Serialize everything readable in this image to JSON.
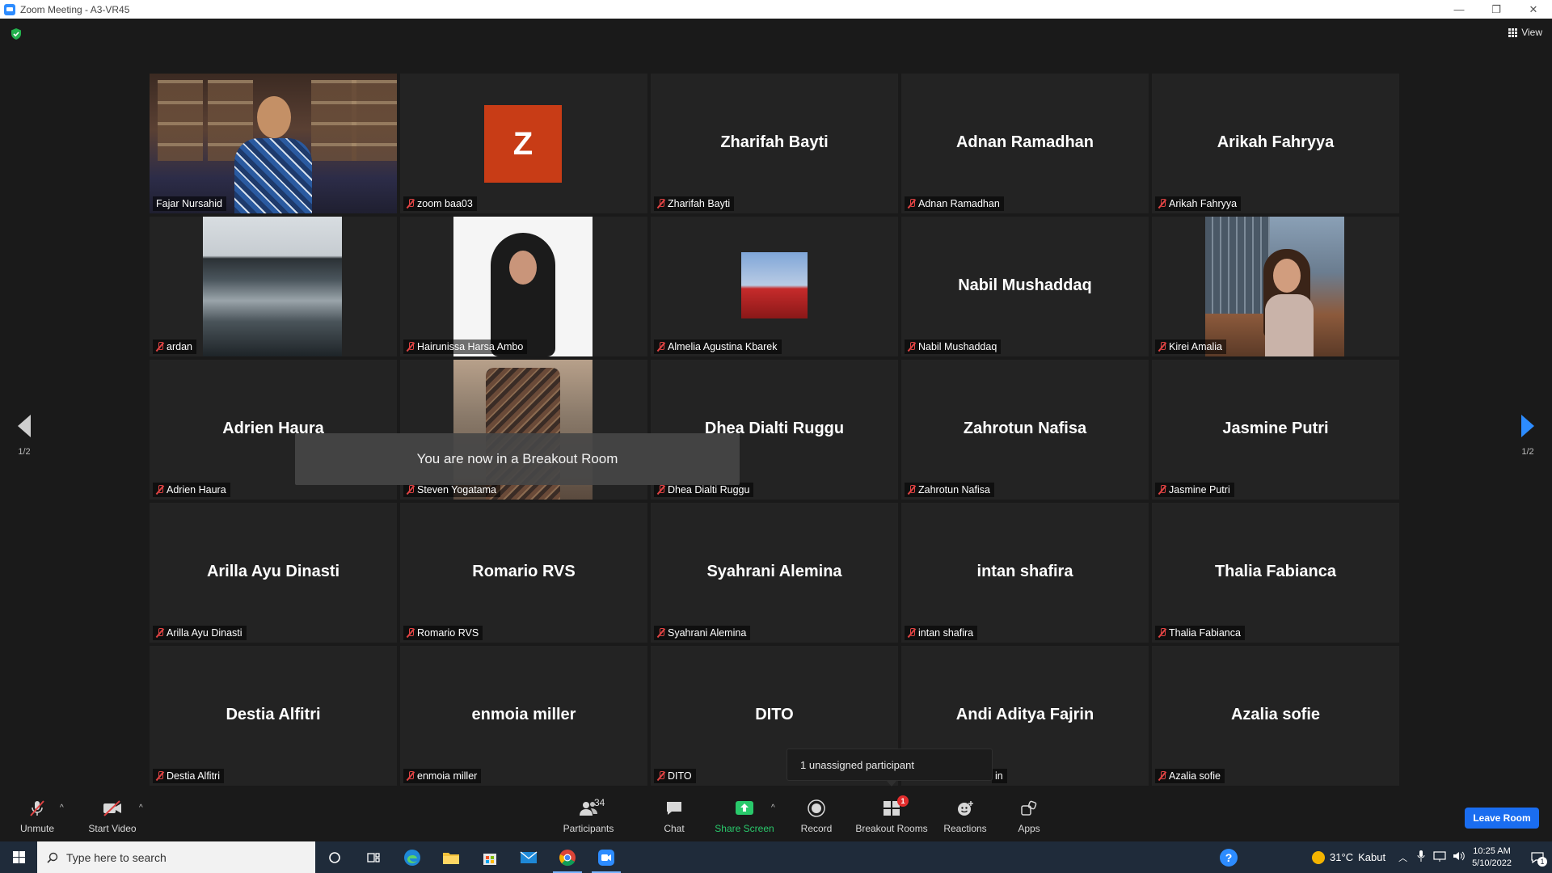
{
  "window": {
    "title": "Zoom Meeting - A3-VR45",
    "minimize": "—",
    "restore": "❐",
    "close": "✕"
  },
  "meeting": {
    "view_label": "View",
    "page_left": "1/2",
    "page_right": "1/2",
    "toast": "You are now in a Breakout Room",
    "tooltip": "1 unassigned participant"
  },
  "tiles": [
    {
      "label": "Fajar Nursahid",
      "type": "video",
      "muted": false
    },
    {
      "label": "zoom baa03",
      "type": "avatar",
      "avatar_letter": "Z",
      "muted": true
    },
    {
      "label": "Zharifah Bayti",
      "bigname": "Zharifah Bayti",
      "muted": true
    },
    {
      "label": "Adnan Ramadhan",
      "bigname": "Adnan Ramadhan",
      "muted": true
    },
    {
      "label": "Arikah Fahryya",
      "bigname": "Arikah Fahryya",
      "muted": true
    },
    {
      "label": "ardan",
      "type": "photo-sea",
      "muted": true
    },
    {
      "label": "Hairunissa Harsa Ambo",
      "type": "photo-hijab",
      "muted": true
    },
    {
      "label": "Almelia Agustina Kbarek",
      "type": "photo-bridge",
      "muted": true
    },
    {
      "label": "Nabil Mushaddaq",
      "bigname": "Nabil Mushaddaq",
      "muted": true
    },
    {
      "label": "Kirei Amalia",
      "type": "photo-girl",
      "muted": true
    },
    {
      "label": "Adrien Haura",
      "bigname": "Adrien Haura",
      "muted": true
    },
    {
      "label": "Steven Yogatama",
      "type": "photo-steven",
      "muted": true
    },
    {
      "label": "Dhea Dialti Ruggu",
      "bigname": "Dhea Dialti Ruggu",
      "muted": true
    },
    {
      "label": "Zahrotun Nafisa",
      "bigname": "Zahrotun Nafisa",
      "muted": true
    },
    {
      "label": "Jasmine Putri",
      "bigname": "Jasmine Putri",
      "muted": true
    },
    {
      "label": "Arilla Ayu Dinasti",
      "bigname": "Arilla Ayu Dinasti",
      "muted": true
    },
    {
      "label": "Romario RVS",
      "bigname": "Romario RVS",
      "muted": true
    },
    {
      "label": "Syahrani Alemina",
      "bigname": "Syahrani Alemina",
      "muted": true
    },
    {
      "label": "intan shafira",
      "bigname": "intan shafira",
      "muted": true
    },
    {
      "label": "Thalia Fabianca",
      "bigname": "Thalia Fabianca",
      "muted": true
    },
    {
      "label": "Destia Alfitri",
      "bigname": "Destia Alfitri",
      "muted": true
    },
    {
      "label": "enmoia miller",
      "bigname": "enmoia miller",
      "muted": true
    },
    {
      "label": "DITO",
      "bigname": "DITO",
      "muted": true
    },
    {
      "label": "in",
      "bigname": "Andi Aditya Fajrin",
      "muted": true
    },
    {
      "label": "Azalia sofie",
      "bigname": "Azalia sofie",
      "muted": true
    }
  ],
  "toolbar": {
    "unmute": "Unmute",
    "start_video": "Start Video",
    "participants": "Participants",
    "participants_count": "34",
    "chat": "Chat",
    "share_screen": "Share Screen",
    "record": "Record",
    "breakout_rooms": "Breakout Rooms",
    "breakout_badge": "1",
    "reactions": "Reactions",
    "apps": "Apps",
    "leave_room": "Leave Room",
    "caret": "^"
  },
  "taskbar": {
    "search_placeholder": "Type here to search",
    "weather_temp": "31°C",
    "weather_desc": "Kabut",
    "time": "10:25 AM",
    "date": "5/10/2022",
    "notification_count": "1"
  },
  "colors": {
    "active_speaker_border": "#e8ef39",
    "avatar_z": "#c83c16",
    "leave_button": "#1a6df0",
    "share_green": "#29c96b",
    "muted_red": "#e04343"
  }
}
